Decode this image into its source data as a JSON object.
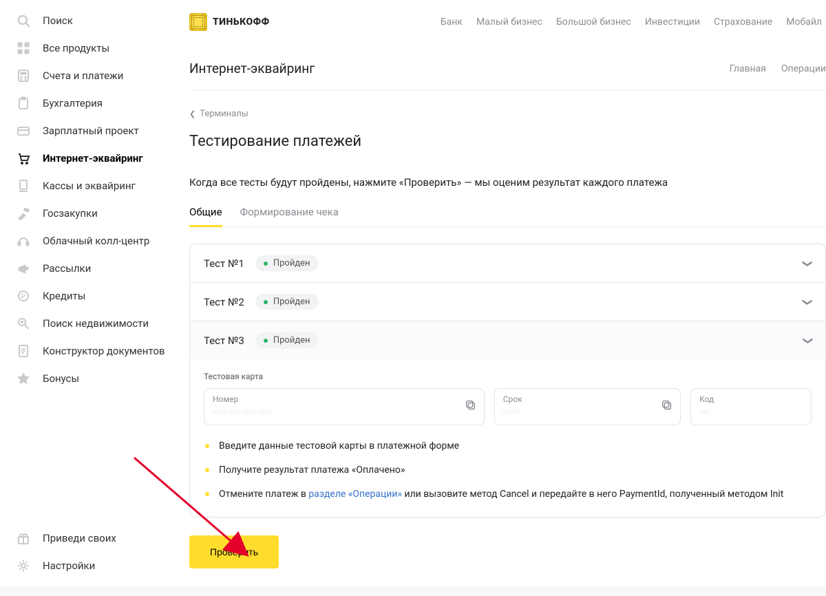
{
  "brand": "ТИНЬКОФФ",
  "sidebar": {
    "items": [
      {
        "label": "Поиск",
        "icon": "search"
      },
      {
        "label": "Все продукты",
        "icon": "grid"
      },
      {
        "label": "Счета и платежи",
        "icon": "calc"
      },
      {
        "label": "Бухгалтерия",
        "icon": "clipboard"
      },
      {
        "label": "Зарплатный проект",
        "icon": "card"
      },
      {
        "label": "Интернет-эквайринг",
        "icon": "cart",
        "active": true
      },
      {
        "label": "Кассы и эквайринг",
        "icon": "pos"
      },
      {
        "label": "Госзакупки",
        "icon": "hammer"
      },
      {
        "label": "Облачный колл-центр",
        "icon": "headset"
      },
      {
        "label": "Рассылки",
        "icon": "megaphone"
      },
      {
        "label": "Кредиты",
        "icon": "coin"
      },
      {
        "label": "Поиск недвижимости",
        "icon": "search-key"
      },
      {
        "label": "Конструктор документов",
        "icon": "doc"
      },
      {
        "label": "Бонусы",
        "icon": "star"
      }
    ],
    "bottom": [
      {
        "label": "Приведи своих",
        "icon": "gift"
      },
      {
        "label": "Настройки",
        "icon": "gear"
      }
    ]
  },
  "top_nav": [
    "Банк",
    "Малый бизнес",
    "Большой бизнес",
    "Инвестиции",
    "Страхование",
    "Мобайл"
  ],
  "section": {
    "title": "Интернет-эквайринг",
    "tabs": [
      "Главная",
      "Операции"
    ]
  },
  "breadcrumb": "Терминалы",
  "page_title": "Тестирование платежей",
  "page_desc": "Когда все тесты будут пройдены, нажмите «Проверить» — мы оценим результат каждого платежа",
  "tabs": [
    {
      "label": "Общие",
      "active": true
    },
    {
      "label": "Формирование чека",
      "active": false
    }
  ],
  "tests": [
    {
      "name": "Тест №1",
      "status": "Пройден",
      "open": false
    },
    {
      "name": "Тест №2",
      "status": "Пройден",
      "open": false
    },
    {
      "name": "Тест №3",
      "status": "Пройден",
      "open": true
    }
  ],
  "card": {
    "section_label": "Тестовая карта",
    "number_label": "Номер",
    "number_value": "•••• •••• •••• ••••",
    "exp_label": "Срок",
    "exp_value": "••/••",
    "cvc_label": "Код",
    "cvc_value": "•••"
  },
  "steps": [
    {
      "pre": "Введите данные тестовой карты в платежной форме"
    },
    {
      "pre": "Получите результат платежа «Оплачено»"
    },
    {
      "pre": "Отмените платеж в ",
      "link": "разделе «Операции»",
      "post": " или вызовите метод Cancel и передайте в него PaymentId, полученный методом Init"
    }
  ],
  "verify_button": "Проверить"
}
